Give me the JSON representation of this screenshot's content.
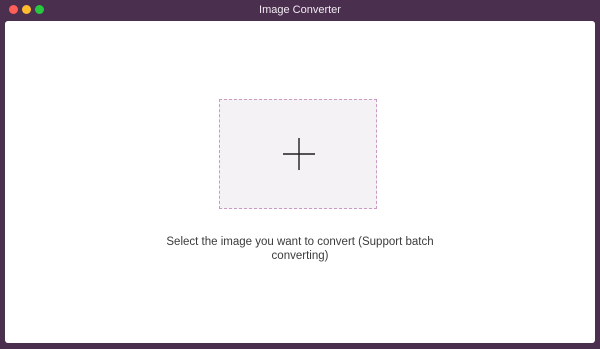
{
  "window": {
    "title": "Image Converter"
  },
  "dropzone": {
    "icon": "plus-icon",
    "caption": "Select the image you want to convert (Support batch converting)"
  },
  "colors": {
    "window_frame": "#4b2f4e",
    "content_background": "#ffffff",
    "dropzone_background": "#f5f2f6",
    "dropzone_border": "#c89ac4",
    "traffic_close": "#fe5f57",
    "traffic_minimize": "#febc2e",
    "traffic_maximize": "#28c840"
  }
}
